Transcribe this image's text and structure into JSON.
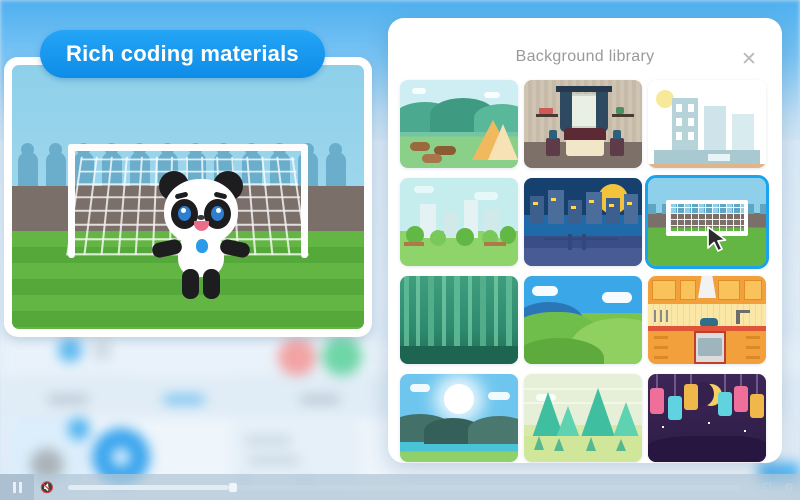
{
  "promo": {
    "badge_label": "Rich coding materials"
  },
  "stage": {
    "name": "project-stage-preview",
    "scene": "soccer-field",
    "sprite": "panda-mascot"
  },
  "dialog": {
    "title": "Background library",
    "close_icon": "close-icon",
    "close_label": "✕",
    "selected_index": 5,
    "accent_color": "#1aa3ef",
    "thumbnails": [
      {
        "id": "camping-lake",
        "name": "camping-lake-thumbnail"
      },
      {
        "id": "bedroom",
        "name": "bedroom-thumbnail"
      },
      {
        "id": "city-day",
        "name": "city-day-thumbnail"
      },
      {
        "id": "city-park",
        "name": "city-park-thumbnail"
      },
      {
        "id": "city-night",
        "name": "city-night-thumbnail"
      },
      {
        "id": "soccer-field",
        "name": "soccer-field-thumbnail"
      },
      {
        "id": "bamboo-forest",
        "name": "bamboo-forest-thumbnail"
      },
      {
        "id": "green-hills",
        "name": "green-hills-thumbnail"
      },
      {
        "id": "kitchen",
        "name": "kitchen-thumbnail"
      },
      {
        "id": "sunrise-lake",
        "name": "sunrise-lake-thumbnail"
      },
      {
        "id": "pine-valley",
        "name": "pine-valley-thumbnail"
      },
      {
        "id": "lantern-night",
        "name": "lantern-night-thumbnail"
      }
    ]
  },
  "player": {
    "play_state": "pause",
    "pause_icon": "pause-icon",
    "mute_icon": "mute-icon",
    "progress_percent": 24,
    "time_label": "",
    "fullscreen_icon": "fullscreen-icon",
    "settings_icon": "settings-icon"
  }
}
